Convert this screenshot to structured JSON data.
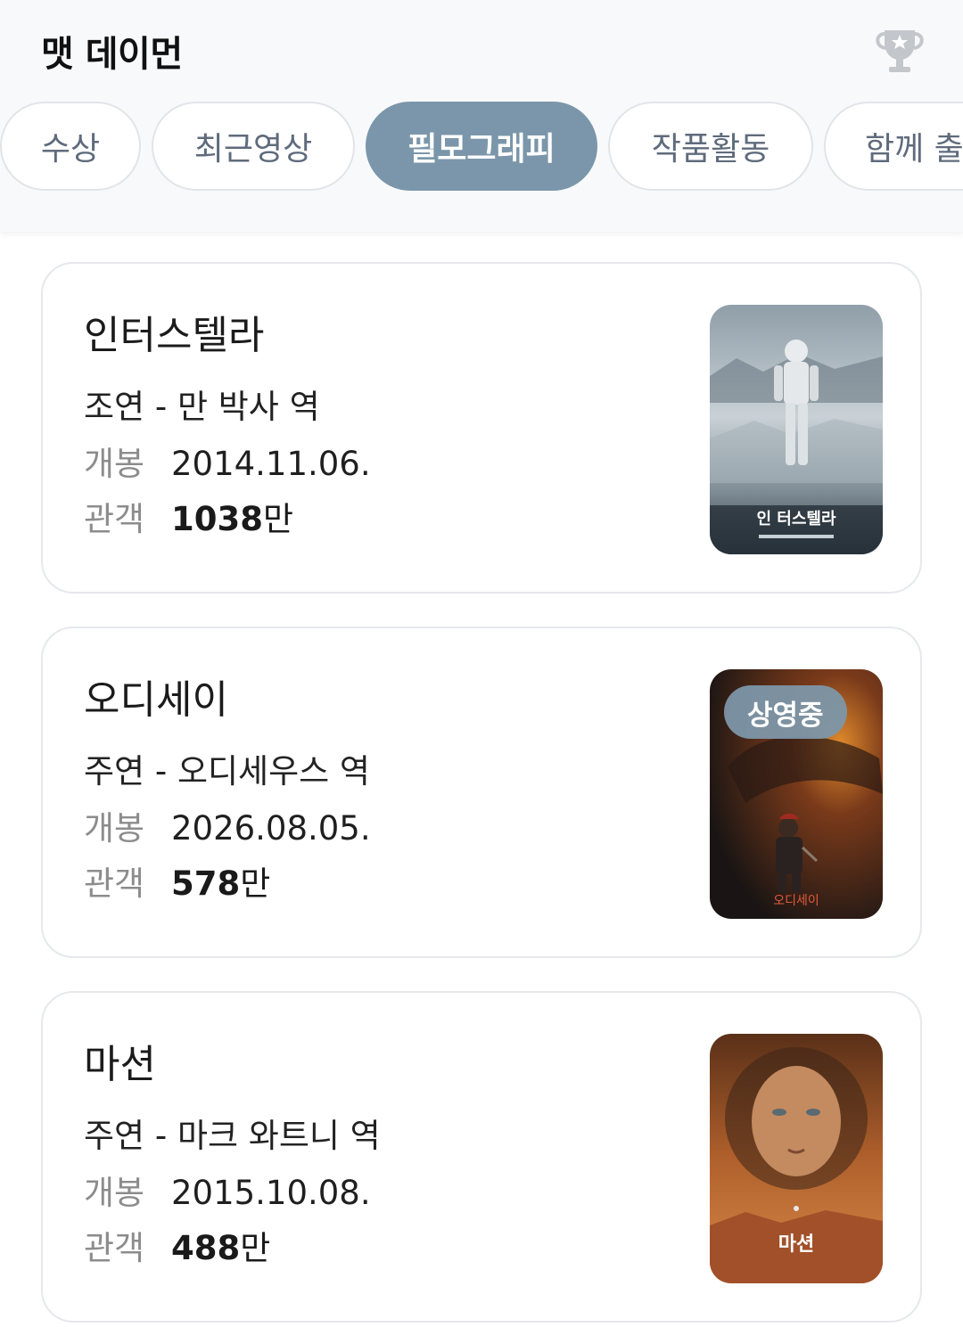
{
  "header": {
    "title": "맷 데이먼",
    "trophy_icon": "trophy-icon"
  },
  "tabs": [
    {
      "label": "수상",
      "active": false
    },
    {
      "label": "최근영상",
      "active": false
    },
    {
      "label": "필모그래피",
      "active": true
    },
    {
      "label": "작품활동",
      "active": false
    },
    {
      "label": "함께 출",
      "active": false
    }
  ],
  "labels": {
    "release": "개봉",
    "audience": "관객"
  },
  "movies": [
    {
      "title": "인터스텔라",
      "role": "조연 - 만 박사 역",
      "release": "2014.11.06.",
      "audience_num": "1038",
      "audience_unit": "만",
      "poster_text": "인 터스텔라",
      "badge": ""
    },
    {
      "title": "오디세이",
      "role": "주연 - 오디세우스 역",
      "release": "2026.08.05.",
      "audience_num": "578",
      "audience_unit": "만",
      "poster_text": "오디세이",
      "badge": "상영중"
    },
    {
      "title": "마션",
      "role": "주연 - 마크 와트니 역",
      "release": "2015.10.08.",
      "audience_num": "488",
      "audience_unit": "만",
      "poster_text": "마션",
      "badge": ""
    }
  ],
  "colors": {
    "active_tab": "#7b96aa",
    "badge": "#7d96a8"
  }
}
